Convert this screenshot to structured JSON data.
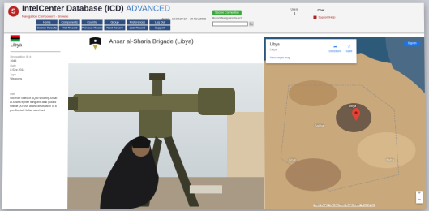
{
  "header": {
    "title": "IntelCenter Database (ICD)",
    "title_suffix": "ADVANCED",
    "subtitle": "Navigation Component - Browse",
    "nav": [
      "Home",
      "Components",
      "Country",
      "Group",
      "Preferences",
      "Log Out",
      "Search Results",
      "First Record",
      "Previous Record",
      "Next Record",
      "Last Record",
      "Support"
    ],
    "datestamp": "Jenert • 10:03:30 ET • 30 Nov 2016",
    "secure_label": "Secure Connection",
    "search_label": "Recent Navigation Search",
    "search_go": "Go",
    "users_label": "Users",
    "users_value": "1",
    "chat_label": "Chat",
    "support_link": "Support/Help"
  },
  "profile": {
    "flag_colors": [
      "#e70013",
      "#000000",
      "#239e46"
    ],
    "country": "Libya",
    "meta": [
      {
        "key": "Recognition ID #",
        "value": "3946"
      },
      {
        "key": "Date",
        "value": "8 Sep 2014"
      },
      {
        "key": "Type",
        "value": "Weapons"
      }
    ],
    "desc_key": "Intel",
    "description": "Still from video of AQIM showing Ansar al-Sharia fighter firing anti-tank guided missile (ATGM) at and destruction of a pro-Shariah Haftar rated tank"
  },
  "entity": {
    "title": "Ansar al-Sharia Brigade (Libya)"
  },
  "map": {
    "card_title": "Libya",
    "card_sub": "Libya",
    "card_link": "View larger map",
    "directions": "Directions",
    "save": "Save",
    "sign_in": "Sign in",
    "zoom_in": "+",
    "zoom_out": "−",
    "attribution": "©2016 Google · Map data ©2016 Google, INEGI · Terms of Use",
    "places": [
      "Libya",
      "Sabha",
      "Kufra",
      "Ghat"
    ]
  }
}
